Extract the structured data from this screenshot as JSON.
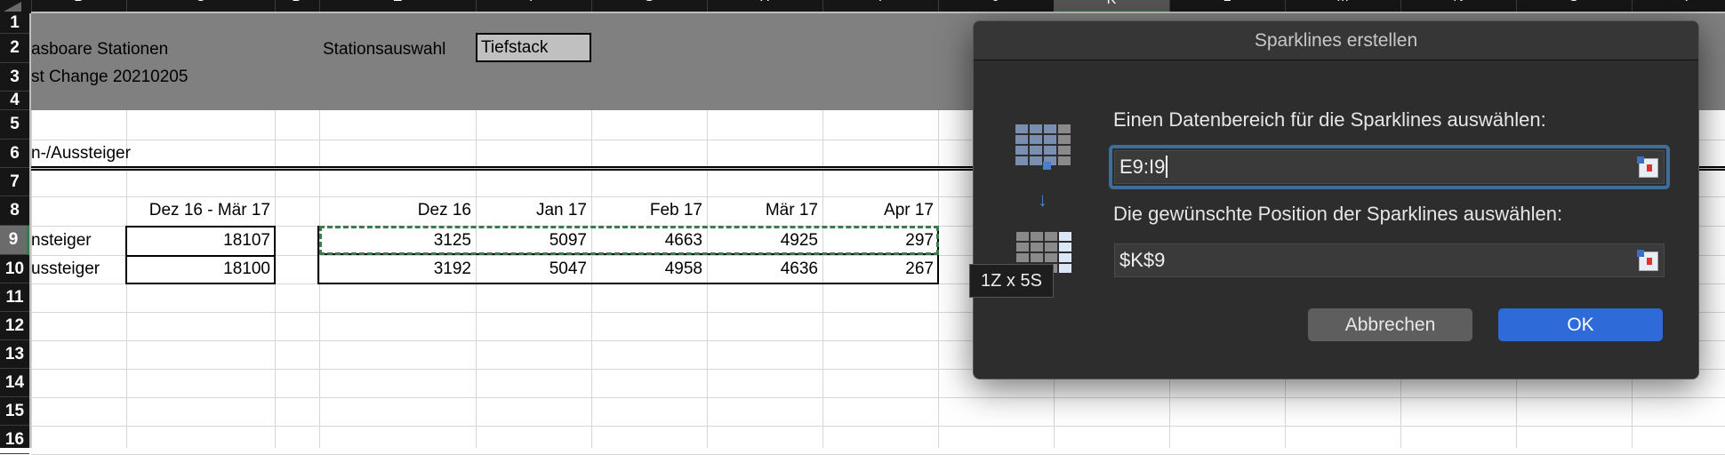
{
  "column_headers": [
    "B",
    "C",
    "D",
    "E",
    "F",
    "G",
    "H",
    "I",
    "J",
    "K",
    "L",
    "M",
    "N",
    "O",
    "P"
  ],
  "selected_column": "K",
  "row_numbers": [
    "1",
    "2",
    "3",
    "4",
    "5",
    "6",
    "7",
    "8",
    "9",
    "10",
    "11",
    "12",
    "13",
    "14",
    "15",
    "16"
  ],
  "selected_row": "9",
  "sheet": {
    "title1": "asboare Stationen",
    "title2": "st Change 20210205",
    "station_label": "Stationsauswahl",
    "station_value": "Tiefstack",
    "section": "n-/Aussteiger",
    "range_header": "Dez 16 - Mär 17",
    "months": [
      "Dez 16",
      "Jan 17",
      "Feb 17",
      "Mär 17",
      "Apr 17"
    ],
    "rows": [
      {
        "label": "nsteiger",
        "total": "18107",
        "values": [
          "3125",
          "5097",
          "4663",
          "4925",
          "297"
        ]
      },
      {
        "label": "ussteiger",
        "total": "18100",
        "values": [
          "3192",
          "5047",
          "4958",
          "4636",
          "267"
        ]
      }
    ]
  },
  "dialog": {
    "title": "Sparklines erstellen",
    "data_range_label": "Einen Datenbereich für die Sparklines auswählen:",
    "data_range_value": "E9:I9",
    "position_label": "Die gewünschte Position der Sparklines auswählen:",
    "position_value": "$K$9",
    "tooltip": "1Z x 5S",
    "cancel": "Abbrechen",
    "ok": "OK",
    "ok_color": "#2f6ad9"
  }
}
